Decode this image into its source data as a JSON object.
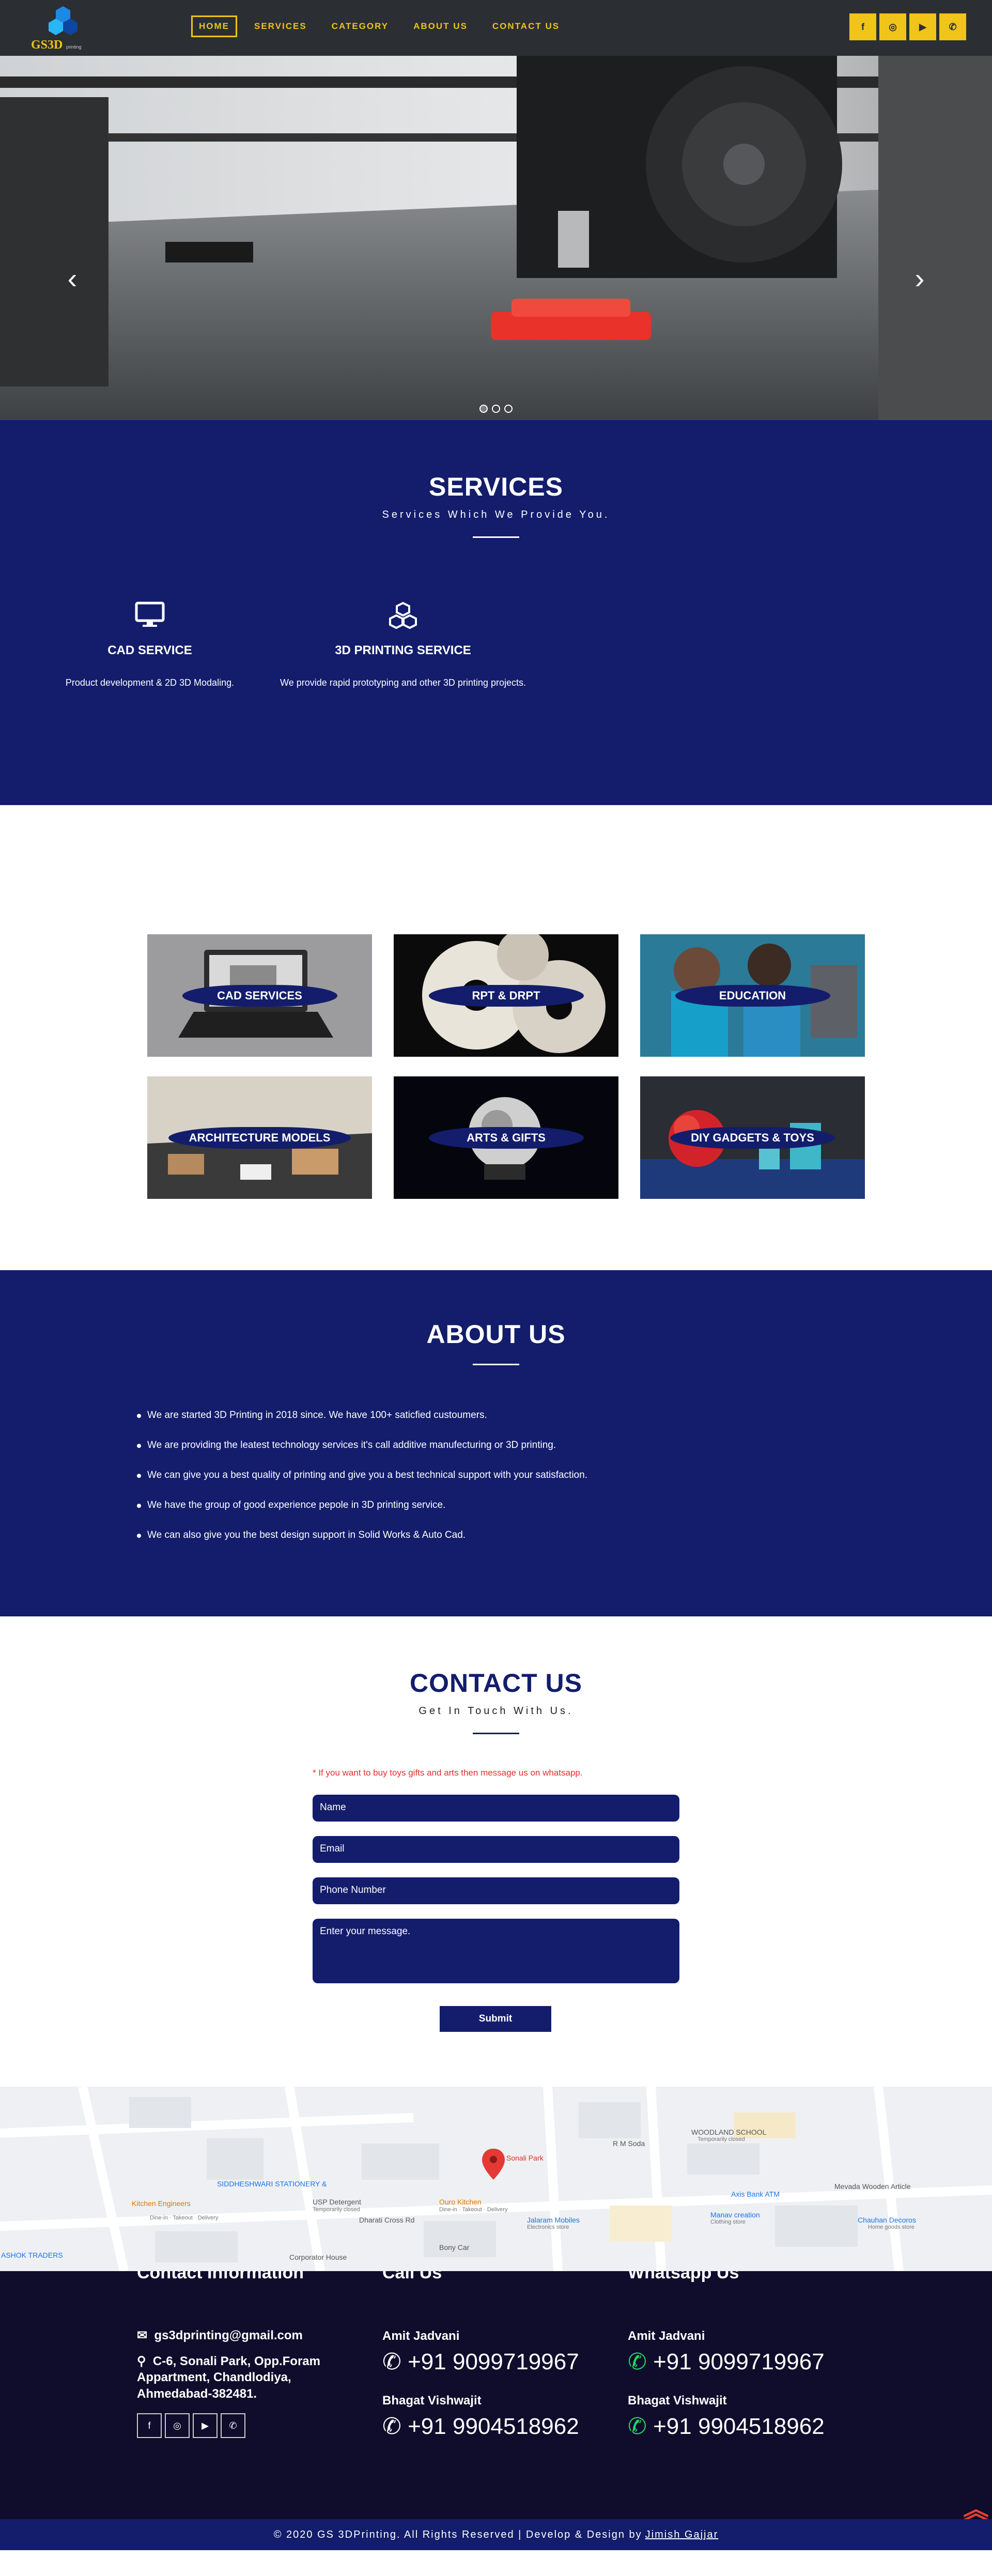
{
  "brand": {
    "name": "GS3D",
    "sub": "printing"
  },
  "nav": {
    "items": [
      {
        "label": "HOME",
        "active": true
      },
      {
        "label": "SERVICES",
        "active": false
      },
      {
        "label": "CATEGORY",
        "active": false
      },
      {
        "label": "ABOUT US",
        "active": false
      },
      {
        "label": "CONTACT US",
        "active": false
      }
    ],
    "socials": [
      {
        "icon": "facebook-icon",
        "glyph": "f"
      },
      {
        "icon": "instagram-icon",
        "glyph": "◎"
      },
      {
        "icon": "youtube-icon",
        "glyph": "▶"
      },
      {
        "icon": "whatsapp-icon",
        "glyph": "✆"
      }
    ]
  },
  "hero": {
    "prev": "‹",
    "next": "›",
    "slide_count": 3,
    "active_slide": 1
  },
  "services": {
    "title": "SERVICES",
    "subtitle": "Services Which We Provide You.",
    "items": [
      {
        "icon": "desktop-icon",
        "glyph": "🖥",
        "title": "CAD SERVICE",
        "desc": "Product development & 2D 3D Modaling."
      },
      {
        "icon": "cubes-icon",
        "glyph": "⬡",
        "title": "3D PRINTING SERVICE",
        "desc": "We provide rapid prototyping and other 3D printing projects."
      }
    ]
  },
  "categories": [
    {
      "label": "CAD SERVICES"
    },
    {
      "label": "RPT & DRPT"
    },
    {
      "label": "EDUCATION"
    },
    {
      "label": "ARCHITECTURE MODELS"
    },
    {
      "label": "ARTS & GIFTS"
    },
    {
      "label": "DIY GADGETS & TOYS"
    }
  ],
  "about": {
    "title": "ABOUT US",
    "points": [
      "We are started 3D Printing in 2018 since. We have 100+ saticfied custoumers.",
      "We are providing the leatest technology services it's call additive manufecturing or 3D printing.",
      "We can give you a best quality of printing and give you a best technical support with your satisfaction.",
      "We have the group of good experience pepole in 3D printing service.",
      "We can also give you the best design support in Solid Works & Auto Cad."
    ]
  },
  "contact": {
    "title": "CONTACT US",
    "subtitle": "Get In Touch With Us.",
    "notice": "* If you want to buy toys gifts and arts then message us on whatsapp.",
    "name_placeholder": "Name",
    "email_placeholder": "Email",
    "phone_placeholder": "Phone Number",
    "message_placeholder": "Enter your message.",
    "submit": "Submit"
  },
  "map": {
    "labels": [
      "Sonali Park",
      "R M Soda",
      "WOODLAND SCHOOL",
      "Temporarily closed",
      "SIDDHESHWARI STATIONERY &",
      "USP Detergent",
      "Temporarily closed",
      "Kitchen Engineers",
      "Dine-in · Takeout · Delivery",
      "Ouro Kitchen",
      "Dine-in · Takeout · Delivery",
      "Axis Bank ATM",
      "Mevada Wooden Article",
      "Manav creation",
      "Clothing store",
      "Jalaram Mobiles",
      "Electronics store",
      "Chauhan Decoros",
      "Home goods store",
      "Dharati Cross Rd",
      "Bony Car",
      "Corporator House",
      "ASHOK TRADERS"
    ]
  },
  "footer": {
    "col1_title": "Contact Information",
    "email": "gs3dprinting@gmail.com",
    "address_1": "C-6, Sonali Park, Opp.Foram",
    "address_2": "Appartment, Chandlodiya,",
    "address_3": "Ahmedabad-382481.",
    "col2_title": "Call Us",
    "col3_title": "Whatsapp Us",
    "person1": "Amit Jadvani",
    "phone1": "+91 9099719967",
    "person2": "Bhagat Vishwajit",
    "phone2": "+91 9904518962",
    "socials": [
      {
        "icon": "facebook-icon",
        "glyph": "f"
      },
      {
        "icon": "instagram-icon",
        "glyph": "◎"
      },
      {
        "icon": "youtube-icon",
        "glyph": "▶"
      },
      {
        "icon": "whatsapp-icon",
        "glyph": "✆"
      }
    ],
    "copyright": "© 2020 GS 3DPrinting. All Rights Reserved | Develop & Design by",
    "designer": "Jimish Gajjar"
  },
  "colors": {
    "navy": "#131d6c",
    "yellow": "#f0c419",
    "dark_nav": "#2b2f33",
    "footer_bg": "#0f0c2c",
    "notice_red": "#e32d2d"
  }
}
